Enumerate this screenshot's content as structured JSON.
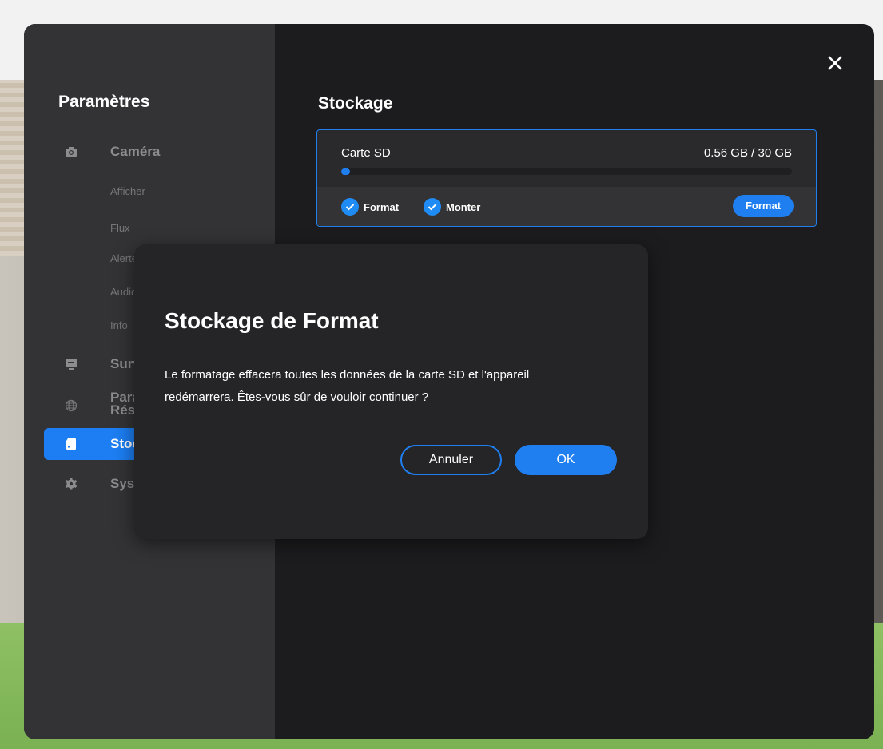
{
  "sidebar": {
    "title": "Paramètres",
    "sections": [
      {
        "label": "Caméra",
        "icon": "camera-icon"
      },
      {
        "label": "Surveillance",
        "icon": "monitor-icon"
      },
      {
        "label": "Paramètres Réseau",
        "label_line1": "Paramètres",
        "label_line2": "Réseau",
        "icon": "globe-icon"
      },
      {
        "label": "Stockage",
        "icon": "sd-card-icon",
        "active": true
      },
      {
        "label": "Système",
        "icon": "gear-icon"
      }
    ],
    "camera_subitems": [
      "Afficher",
      "Flux",
      "Alerte",
      "Audio",
      "Info"
    ]
  },
  "close_icon": "close-icon",
  "main": {
    "title": "Stockage",
    "sd_card": {
      "name": "Carte SD",
      "usage": "0.56 GB / 30 GB",
      "used_fraction": 0.019,
      "statuses": [
        "Format",
        "Monter"
      ],
      "format_button": "Format"
    }
  },
  "dialog": {
    "title": "Stockage de Format",
    "message_line1": "Le formatage effacera toutes les données de la carte SD et l'appareil",
    "message_line2": "redémarrera. Êtes-vous sûr de vouloir continuer ?",
    "cancel_label": "Annuler",
    "ok_label": "OK"
  },
  "colors": {
    "accent": "#1f7ff0",
    "panel": "#1c1c1e",
    "sidebar": "#333335",
    "dialog": "#252527"
  }
}
